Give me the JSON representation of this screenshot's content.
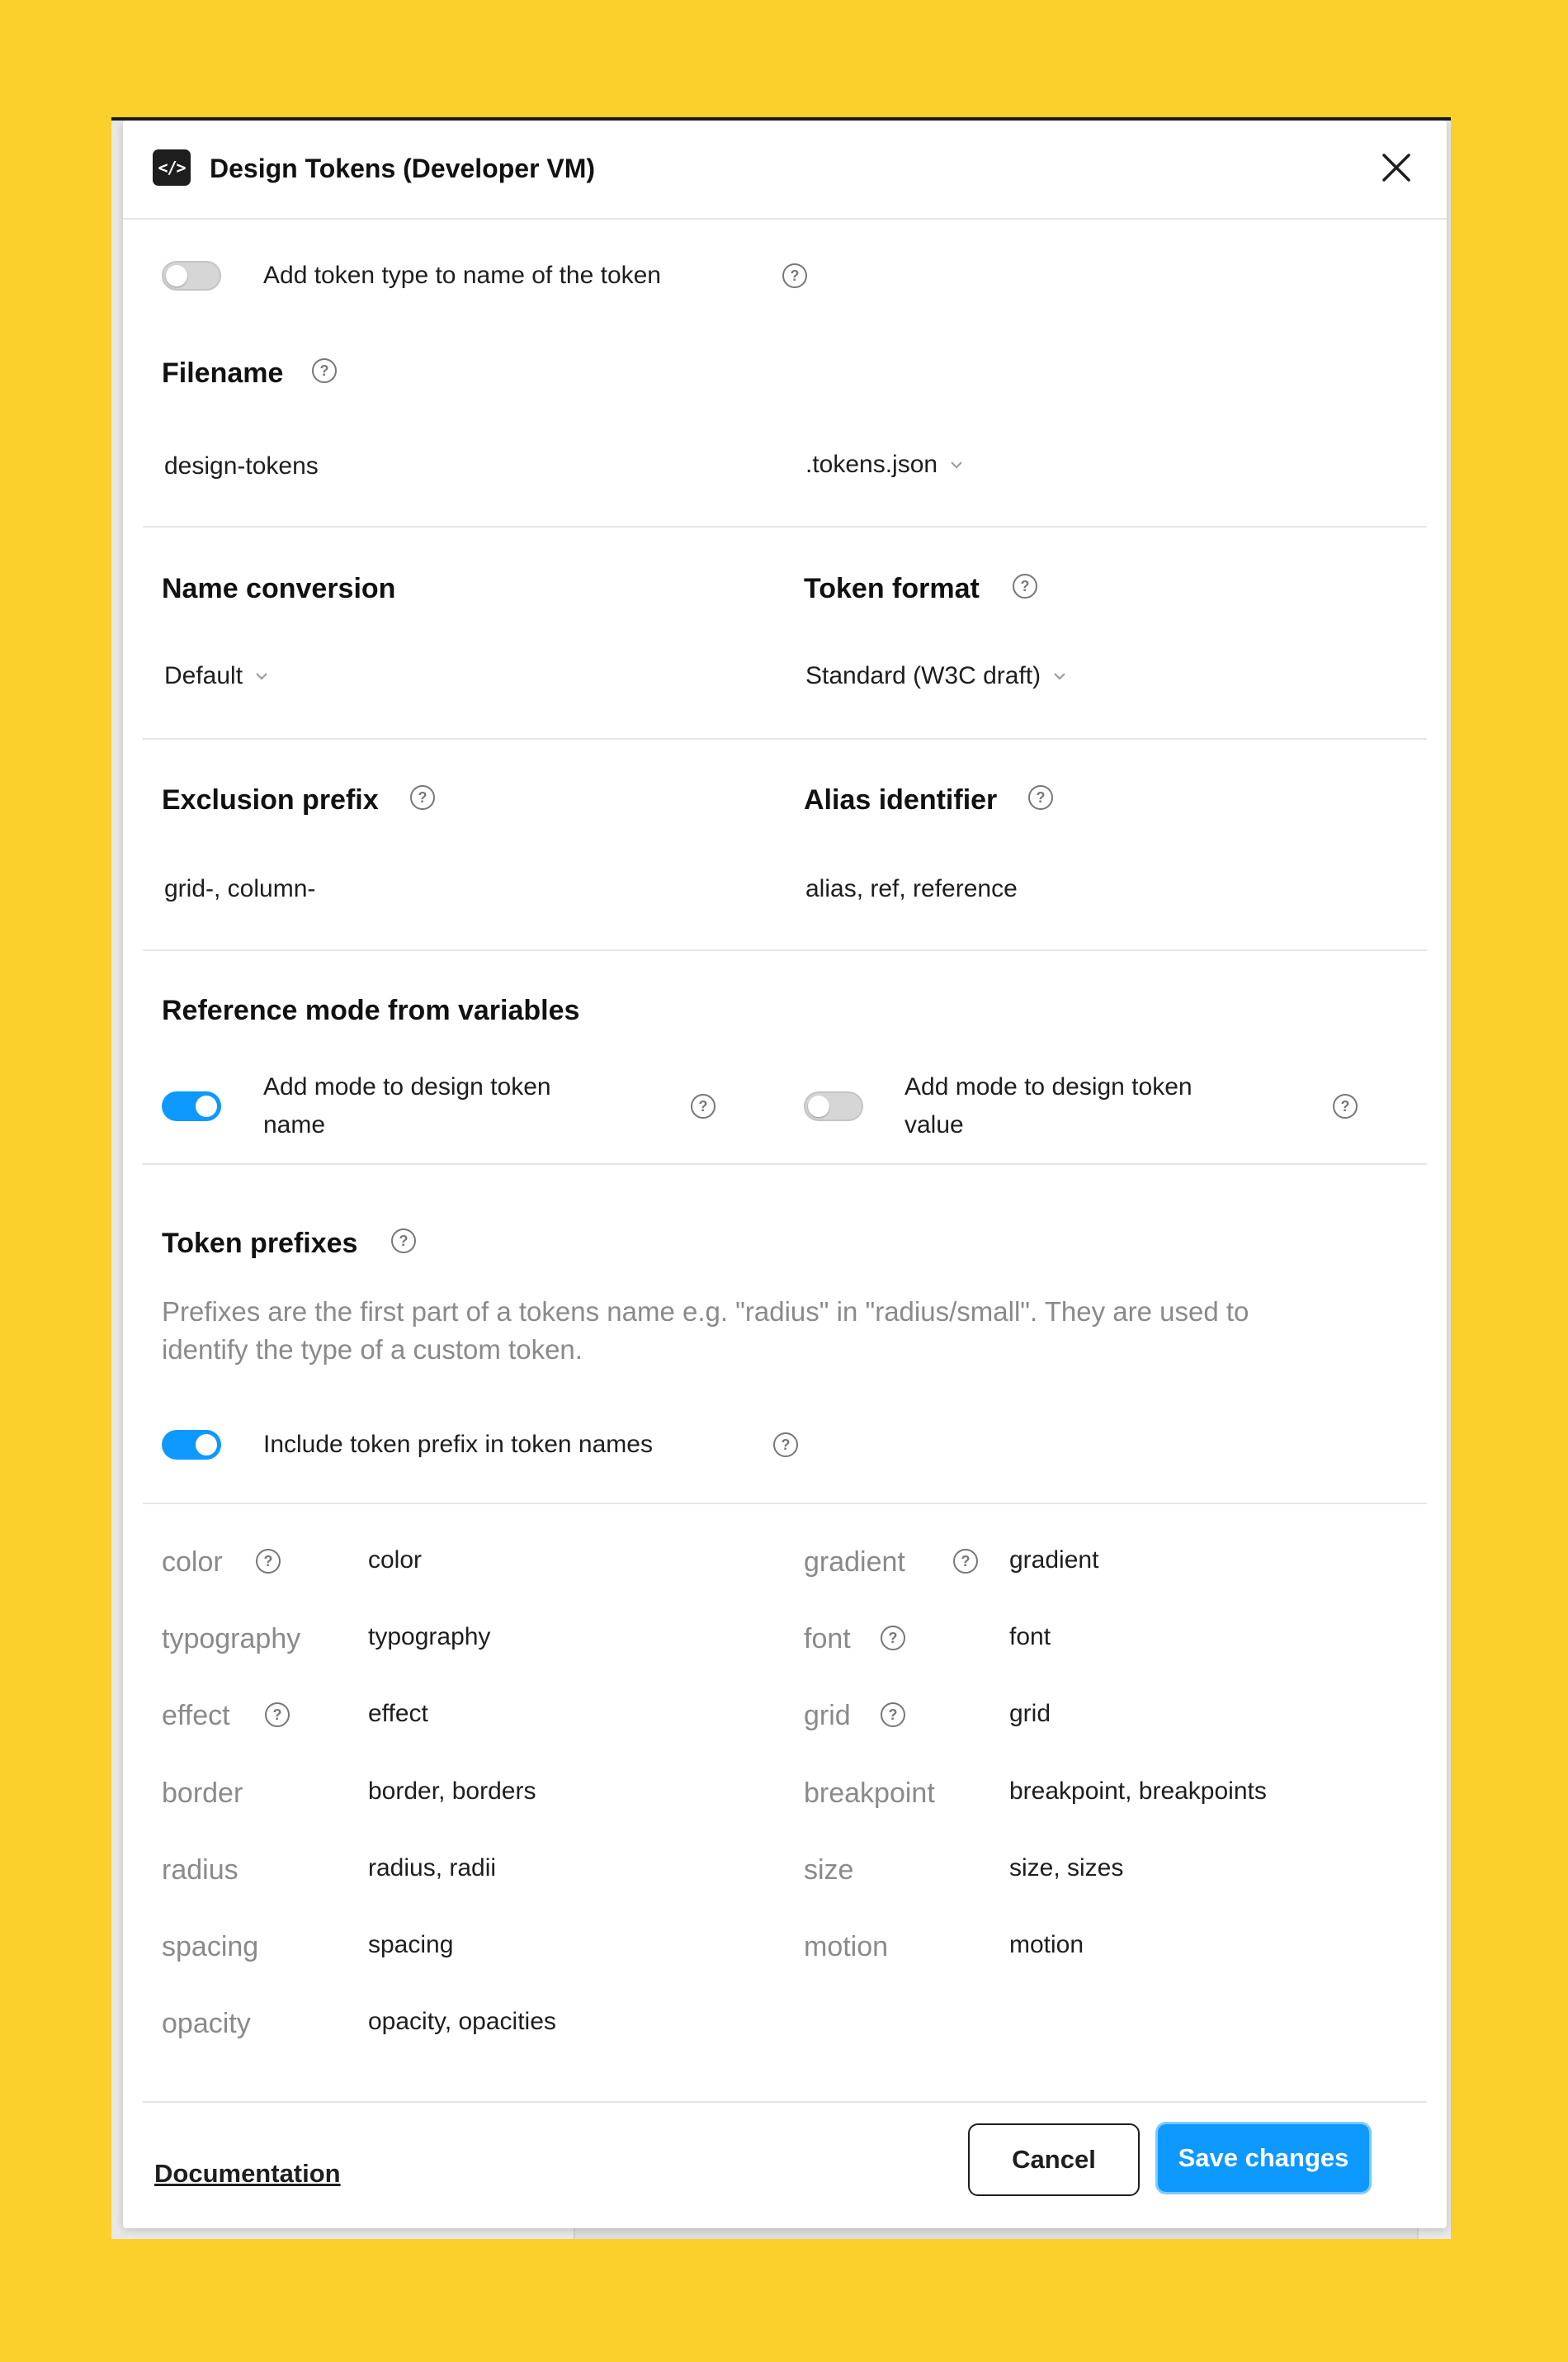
{
  "dialog": {
    "title": "Design Tokens (Developer VM)",
    "app_icon": "code-brackets-icon",
    "close_icon": "close-icon"
  },
  "settings": {
    "add_type_toggle": {
      "label": "Add token type to name of the token",
      "on": false
    },
    "filename": {
      "heading": "Filename",
      "value": "design-tokens",
      "extension": ".tokens.json"
    },
    "name_conversion": {
      "heading": "Name conversion",
      "value": "Default"
    },
    "token_format": {
      "heading": "Token format",
      "value": "Standard (W3C draft)"
    },
    "exclusion_prefix": {
      "heading": "Exclusion prefix",
      "value": "grid-, column-"
    },
    "alias_identifier": {
      "heading": "Alias identifier",
      "value": "alias, ref, reference"
    },
    "reference_mode": {
      "heading": "Reference mode from variables",
      "mode_name": {
        "label_line1": "Add mode to design token",
        "label_line2": "name",
        "on": true
      },
      "mode_value": {
        "label_line1": "Add mode to design token",
        "label_line2": "value",
        "on": false
      }
    },
    "token_prefixes": {
      "heading": "Token prefixes",
      "description_line1": "Prefixes are the first part of a tokens name e.g. \"radius\" in \"radius/small\". They are used to",
      "description_line2": "identify the type of a custom token.",
      "include_toggle": {
        "label": "Include token prefix in token names",
        "on": true
      },
      "left": [
        {
          "key": "color",
          "value": "color",
          "help": true
        },
        {
          "key": "typography",
          "value": "typography",
          "help": false
        },
        {
          "key": "effect",
          "value": "effect",
          "help": true
        },
        {
          "key": "border",
          "value": "border, borders",
          "help": false
        },
        {
          "key": "radius",
          "value": "radius, radii",
          "help": false
        },
        {
          "key": "spacing",
          "value": "spacing",
          "help": false
        },
        {
          "key": "opacity",
          "value": "opacity, opacities",
          "help": false
        }
      ],
      "right": [
        {
          "key": "gradient",
          "value": "gradient",
          "help": true
        },
        {
          "key": "font",
          "value": "font",
          "help": true
        },
        {
          "key": "grid",
          "value": "grid",
          "help": true
        },
        {
          "key": "breakpoint",
          "value": "breakpoint, breakpoints",
          "help": false
        },
        {
          "key": "size",
          "value": "size, sizes",
          "help": false
        },
        {
          "key": "motion",
          "value": "motion",
          "help": false
        }
      ]
    }
  },
  "footer": {
    "documentation": "Documentation",
    "cancel": "Cancel",
    "save": "Save changes"
  },
  "colors": {
    "background": "#FCD02C",
    "accent": "#0D99FF",
    "muted_text": "#8A8A8A"
  },
  "icons": {
    "help": "help-circle-icon",
    "chevron": "chevron-down-icon"
  }
}
